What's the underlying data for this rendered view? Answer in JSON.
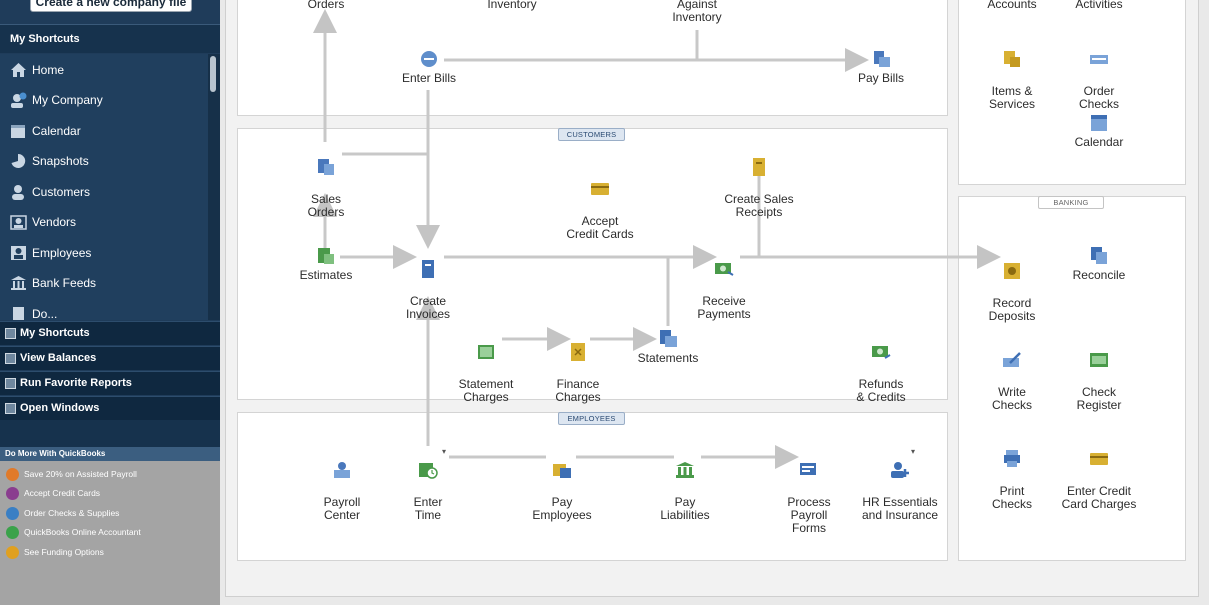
{
  "sidebar": {
    "create_button": "Create a new company file",
    "header": "My Shortcuts",
    "items": [
      "Home",
      "My Company",
      "Calendar",
      "Snapshots",
      "Customers",
      "Vendors",
      "Employees",
      "Bank Feeds",
      "Do..."
    ],
    "item_icons": [
      "home-icon",
      "my-company-icon",
      "calendar-icon",
      "snapshots-icon",
      "customers-icon",
      "vendors-icon",
      "employees-icon",
      "bank-feeds-icon",
      "docs-icon"
    ],
    "sections": [
      "My Shortcuts",
      "View Balances",
      "Run Favorite Reports",
      "Open Windows"
    ],
    "do_more_header": "Do More With QuickBooks",
    "do_more": [
      {
        "label": "Save 20% on Assisted Payroll",
        "icon": "payroll-plus-icon",
        "color": "#e07a2a"
      },
      {
        "label": "Accept Credit Cards",
        "icon": "credit-card-icon",
        "color": "#8a3d8f"
      },
      {
        "label": "Order Checks & Supplies",
        "icon": "checks-icon",
        "color": "#3a7fc4"
      },
      {
        "label": "QuickBooks Online Accountant",
        "icon": "plus-icon",
        "color": "#3aa24a"
      },
      {
        "label": "See Funding Options",
        "icon": "dollar-icon",
        "color": "#e0a020"
      }
    ]
  },
  "panels": {
    "customers_tag": "CUSTOMERS",
    "employees_tag": "EMPLOYEES",
    "banking_tag": "BANKING"
  },
  "workflow": {
    "vendors": {
      "purchase_orders": "Orders",
      "receive_inventory": "Inventory",
      "enter_bills_against": "Against\nInventory",
      "enter_bills": "Enter Bills",
      "pay_bills": "Pay Bills"
    },
    "customers": {
      "sales_orders": "Sales\nOrders",
      "accept_credit_cards": "Accept\nCredit Cards",
      "create_sales_receipts": "Create Sales\nReceipts",
      "estimates": "Estimates",
      "create_invoices": "Create\nInvoices",
      "receive_payments": "Receive\nPayments",
      "statement_charges": "Statement\nCharges",
      "finance_charges": "Finance\nCharges",
      "statements": "Statements",
      "refunds_credits": "Refunds\n& Credits"
    },
    "employees": {
      "payroll_center": "Payroll\nCenter",
      "enter_time": "Enter\nTime",
      "pay_employees": "Pay\nEmployees",
      "pay_liabilities": "Pay\nLiabilities",
      "process_payroll_forms": "Process\nPayroll\nForms",
      "hr_essentials": "HR Essentials\nand Insurance"
    },
    "company": {
      "chart_of_accounts": "Accounts",
      "inventory_activities": "Activities",
      "items_services": "Items &\nServices",
      "order_checks": "Order\nChecks",
      "calendar": "Calendar"
    },
    "banking": {
      "record_deposits": "Record\nDeposits",
      "reconcile": "Reconcile",
      "write_checks": "Write\nChecks",
      "check_register": "Check\nRegister",
      "print_checks": "Print\nChecks",
      "enter_credit_card_charges": "Enter Credit\nCard Charges"
    }
  },
  "colors": {
    "sidebar_bg": "#1f3c5a",
    "arrow": "#c8c8c8",
    "tag_blue": "#dde6f1",
    "icon_blue": "#3e6fb4",
    "icon_gold": "#d8b032",
    "icon_green": "#4a9a4a"
  }
}
